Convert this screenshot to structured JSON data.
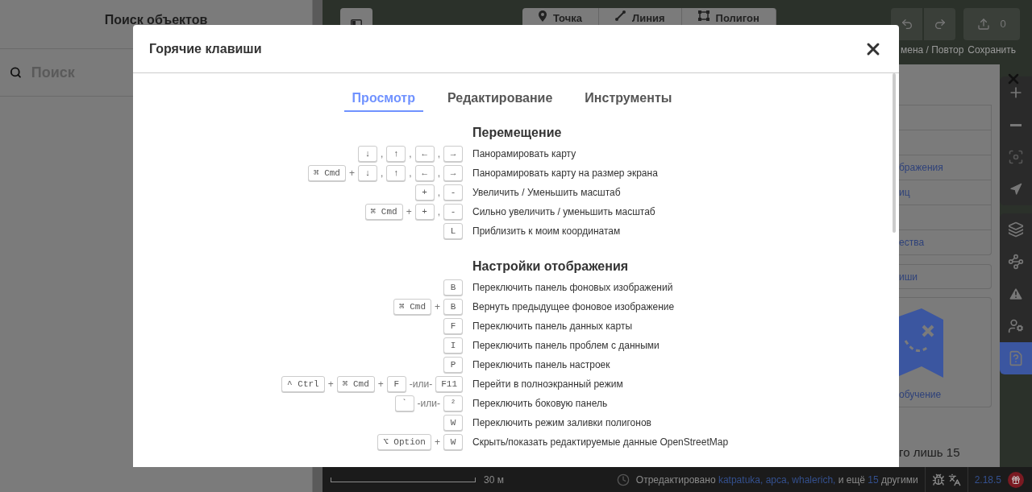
{
  "sidebar": {
    "title": "Поиск объектов",
    "search": {
      "placeholder": "Поиск"
    }
  },
  "toolbar": {
    "modes": [
      {
        "label": "Точка",
        "kind": "point"
      },
      {
        "label": "Линия",
        "kind": "line"
      },
      {
        "label": "Полигон",
        "kind": "area"
      }
    ],
    "undo_label": "мена / Повтор",
    "save_label": "Сохранить",
    "save_count": "0"
  },
  "help_panel": {
    "rows": [
      "бражения",
      "иц",
      "ества"
    ],
    "shortcuts_row": "иши",
    "walkthrough": "обучение",
    "footer_text": "го лишь 15"
  },
  "footer": {
    "scale": "30 м",
    "attribution": {
      "prefix": "Отредактировано",
      "users": [
        "katpatuka,",
        "apca,",
        "whalerich,"
      ],
      "middle": "и ещё",
      "count": "15",
      "suffix": "другими"
    },
    "version": "2.18.5"
  },
  "modal": {
    "title": "Горячие клавиши",
    "tabs": [
      {
        "label": "Просмотр",
        "selected": true
      },
      {
        "label": "Редактирование",
        "selected": false
      },
      {
        "label": "Инструменты",
        "selected": false
      }
    ],
    "sections": [
      {
        "title": "Перемещение",
        "rows": [
          {
            "keys": [
              {
                "kind": "key",
                "text": "↓"
              },
              {
                "kind": "sep",
                "text": ","
              },
              {
                "kind": "key",
                "text": "↑"
              },
              {
                "kind": "sep",
                "text": ","
              },
              {
                "kind": "key",
                "text": "←"
              },
              {
                "kind": "sep",
                "text": ","
              },
              {
                "kind": "key",
                "text": "→"
              }
            ],
            "text": "Панорамировать карту"
          },
          {
            "keys": [
              {
                "kind": "key",
                "text": "⌘ Cmd"
              },
              {
                "kind": "sep",
                "text": "+"
              },
              {
                "kind": "key",
                "text": "↓"
              },
              {
                "kind": "sep",
                "text": ","
              },
              {
                "kind": "key",
                "text": "↑"
              },
              {
                "kind": "sep",
                "text": ","
              },
              {
                "kind": "key",
                "text": "←"
              },
              {
                "kind": "sep",
                "text": ","
              },
              {
                "kind": "key",
                "text": "→"
              }
            ],
            "text": "Панорамировать карту на размер экрана"
          },
          {
            "keys": [
              {
                "kind": "key",
                "text": "+"
              },
              {
                "kind": "sep",
                "text": ","
              },
              {
                "kind": "key",
                "text": "-"
              }
            ],
            "text": "Увеличить / Уменьшить масштаб"
          },
          {
            "keys": [
              {
                "kind": "key",
                "text": "⌘ Cmd"
              },
              {
                "kind": "sep",
                "text": "+"
              },
              {
                "kind": "key",
                "text": "+"
              },
              {
                "kind": "sep",
                "text": ","
              },
              {
                "kind": "key",
                "text": "-"
              }
            ],
            "text": "Сильно увеличить / уменьшить масштаб"
          },
          {
            "keys": [
              {
                "kind": "key",
                "text": "L"
              }
            ],
            "text": "Приблизить к моим координатам"
          }
        ]
      },
      {
        "title": "Настройки отображения",
        "rows": [
          {
            "keys": [
              {
                "kind": "key",
                "text": "B"
              }
            ],
            "text": "Переключить панель фоновых изображений"
          },
          {
            "keys": [
              {
                "kind": "key",
                "text": "⌘ Cmd"
              },
              {
                "kind": "sep",
                "text": "+"
              },
              {
                "kind": "key",
                "text": "B"
              }
            ],
            "text": "Вернуть предыдущее фоновое изображение"
          },
          {
            "keys": [
              {
                "kind": "key",
                "text": "F"
              }
            ],
            "text": "Переключить панель данных карты"
          },
          {
            "keys": [
              {
                "kind": "key",
                "text": "I"
              }
            ],
            "text": "Переключить панель проблем с данными"
          },
          {
            "keys": [
              {
                "kind": "key",
                "text": "P"
              }
            ],
            "text": "Переключить панель настроек"
          },
          {
            "keys": [
              {
                "kind": "key",
                "text": "^ Ctrl"
              },
              {
                "kind": "sep",
                "text": "+"
              },
              {
                "kind": "key",
                "text": "⌘ Cmd"
              },
              {
                "kind": "sep",
                "text": "+"
              },
              {
                "kind": "key",
                "text": "F"
              },
              {
                "kind": "sep",
                "text": "-или-"
              },
              {
                "kind": "key",
                "text": "F11"
              }
            ],
            "text": "Перейти в полноэкранный режим"
          },
          {
            "keys": [
              {
                "kind": "key",
                "text": "`"
              },
              {
                "kind": "sep",
                "text": "-или-"
              },
              {
                "kind": "key",
                "text": "²"
              }
            ],
            "text": "Переключить боковую панель"
          },
          {
            "keys": [
              {
                "kind": "key",
                "text": "W"
              }
            ],
            "text": "Переключить режим заливки полигонов"
          },
          {
            "keys": [
              {
                "kind": "key",
                "text": "⌥ Option"
              },
              {
                "kind": "sep",
                "text": "+"
              },
              {
                "kind": "key",
                "text": "W"
              }
            ],
            "text": "Скрыть/показать редактируемые данные OpenStreetMap"
          }
        ]
      }
    ]
  }
}
